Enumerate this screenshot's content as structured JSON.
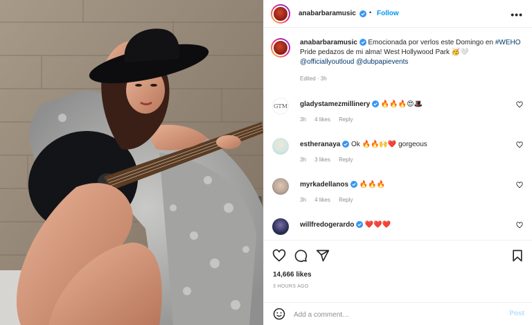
{
  "post_author": {
    "username": "anabarbaramusic",
    "follow_label": "Follow",
    "separator": "•",
    "more_label": "•••"
  },
  "caption": {
    "username": "anabarbaramusic",
    "text_1": "Emocionada por verlos este Domingo en",
    "hashtag": "#WEHO",
    "text_2": " Pride pedazos de mi alma! West Hollywood Park 🥳🤍",
    "mention_1": "@officiallyoutloud",
    "mention_2": "@dubpapievents",
    "meta": "Edited · 3h"
  },
  "comments": [
    {
      "username": "gladystamezmillinery",
      "text": "🔥🔥🔥😍🎩",
      "time": "3h",
      "likes": "4 likes",
      "reply": "Reply",
      "avatar_color": "#ffffff"
    },
    {
      "username": "estheranaya",
      "text": "Ok 🔥🔥🙌❤️ gorgeous",
      "time": "3h",
      "likes": "3 likes",
      "reply": "Reply",
      "avatar_color": "#cfe7e2"
    },
    {
      "username": "myrkadellanos",
      "text": "🔥🔥🔥",
      "time": "3h",
      "likes": "4 likes",
      "reply": "Reply",
      "avatar_color": "#b7a79a"
    },
    {
      "username": "willfredogerardo",
      "text": "❤️❤️❤️",
      "time": "",
      "likes": "",
      "reply": "",
      "avatar_color": "#2a2f55"
    }
  ],
  "commenter_logo": "GTM",
  "actions": {
    "likes": "14,666 likes",
    "time_ago": "3 HOURS AGO"
  },
  "composer": {
    "placeholder": "Add a comment…",
    "post_label": "Post"
  },
  "colors": {
    "accent": "#0095f6",
    "verified": "#3897f0",
    "muted": "#8e8e8e",
    "border": "#efefef"
  }
}
